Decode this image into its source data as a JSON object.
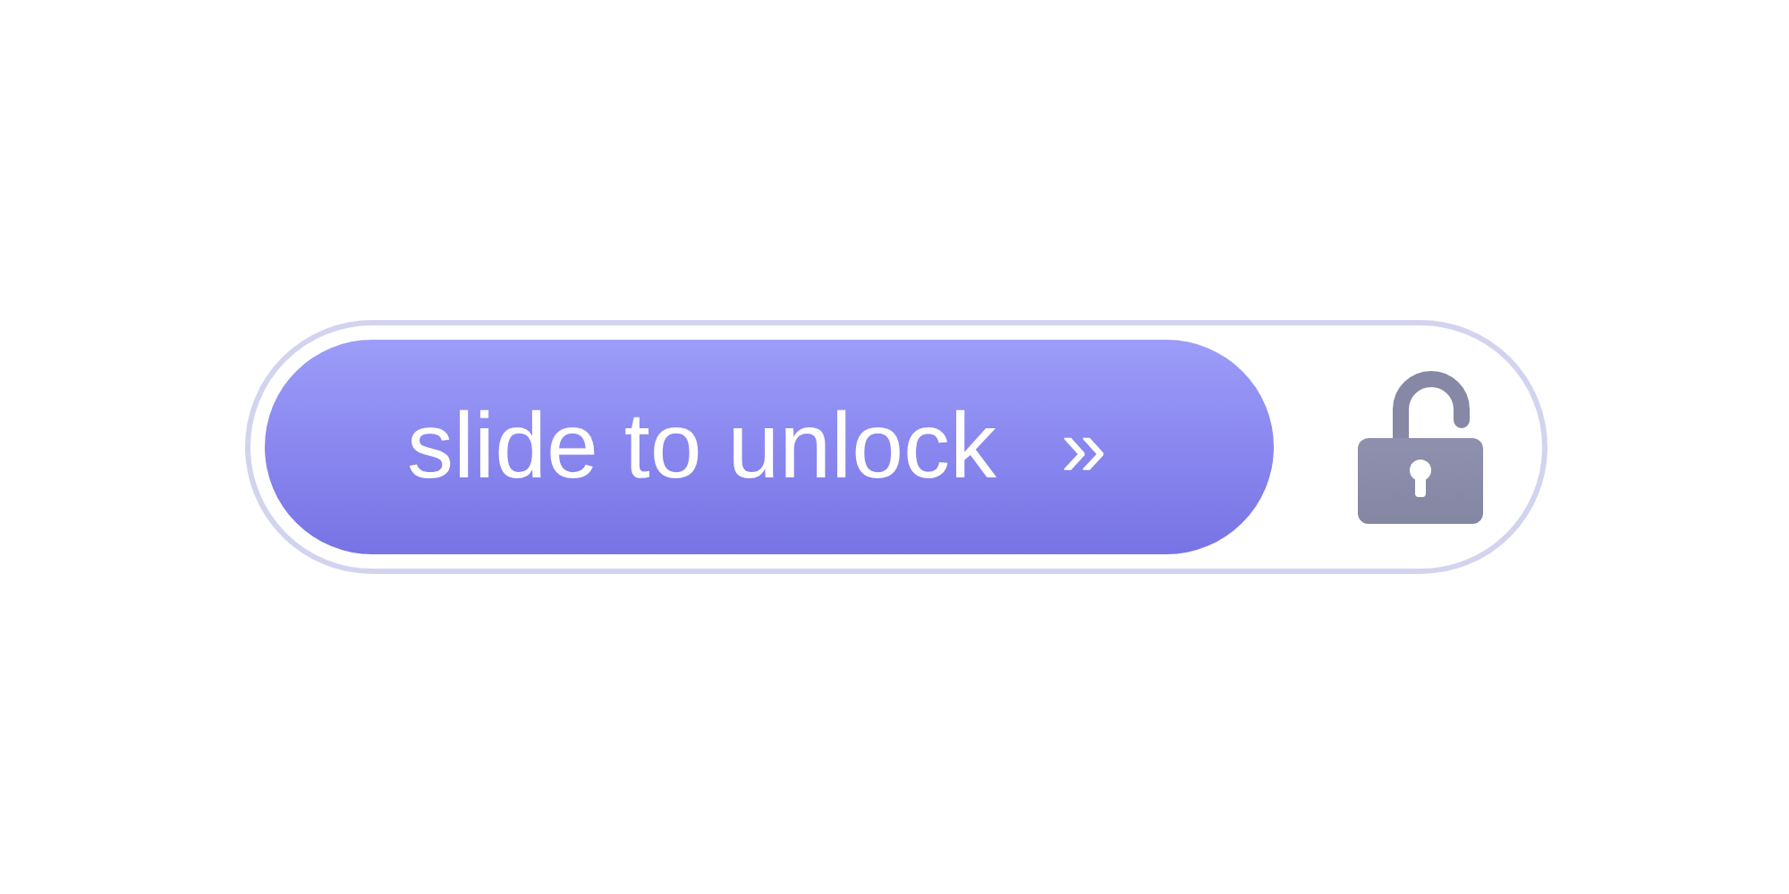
{
  "slider": {
    "label": "slide to unlock",
    "arrow": "»"
  }
}
